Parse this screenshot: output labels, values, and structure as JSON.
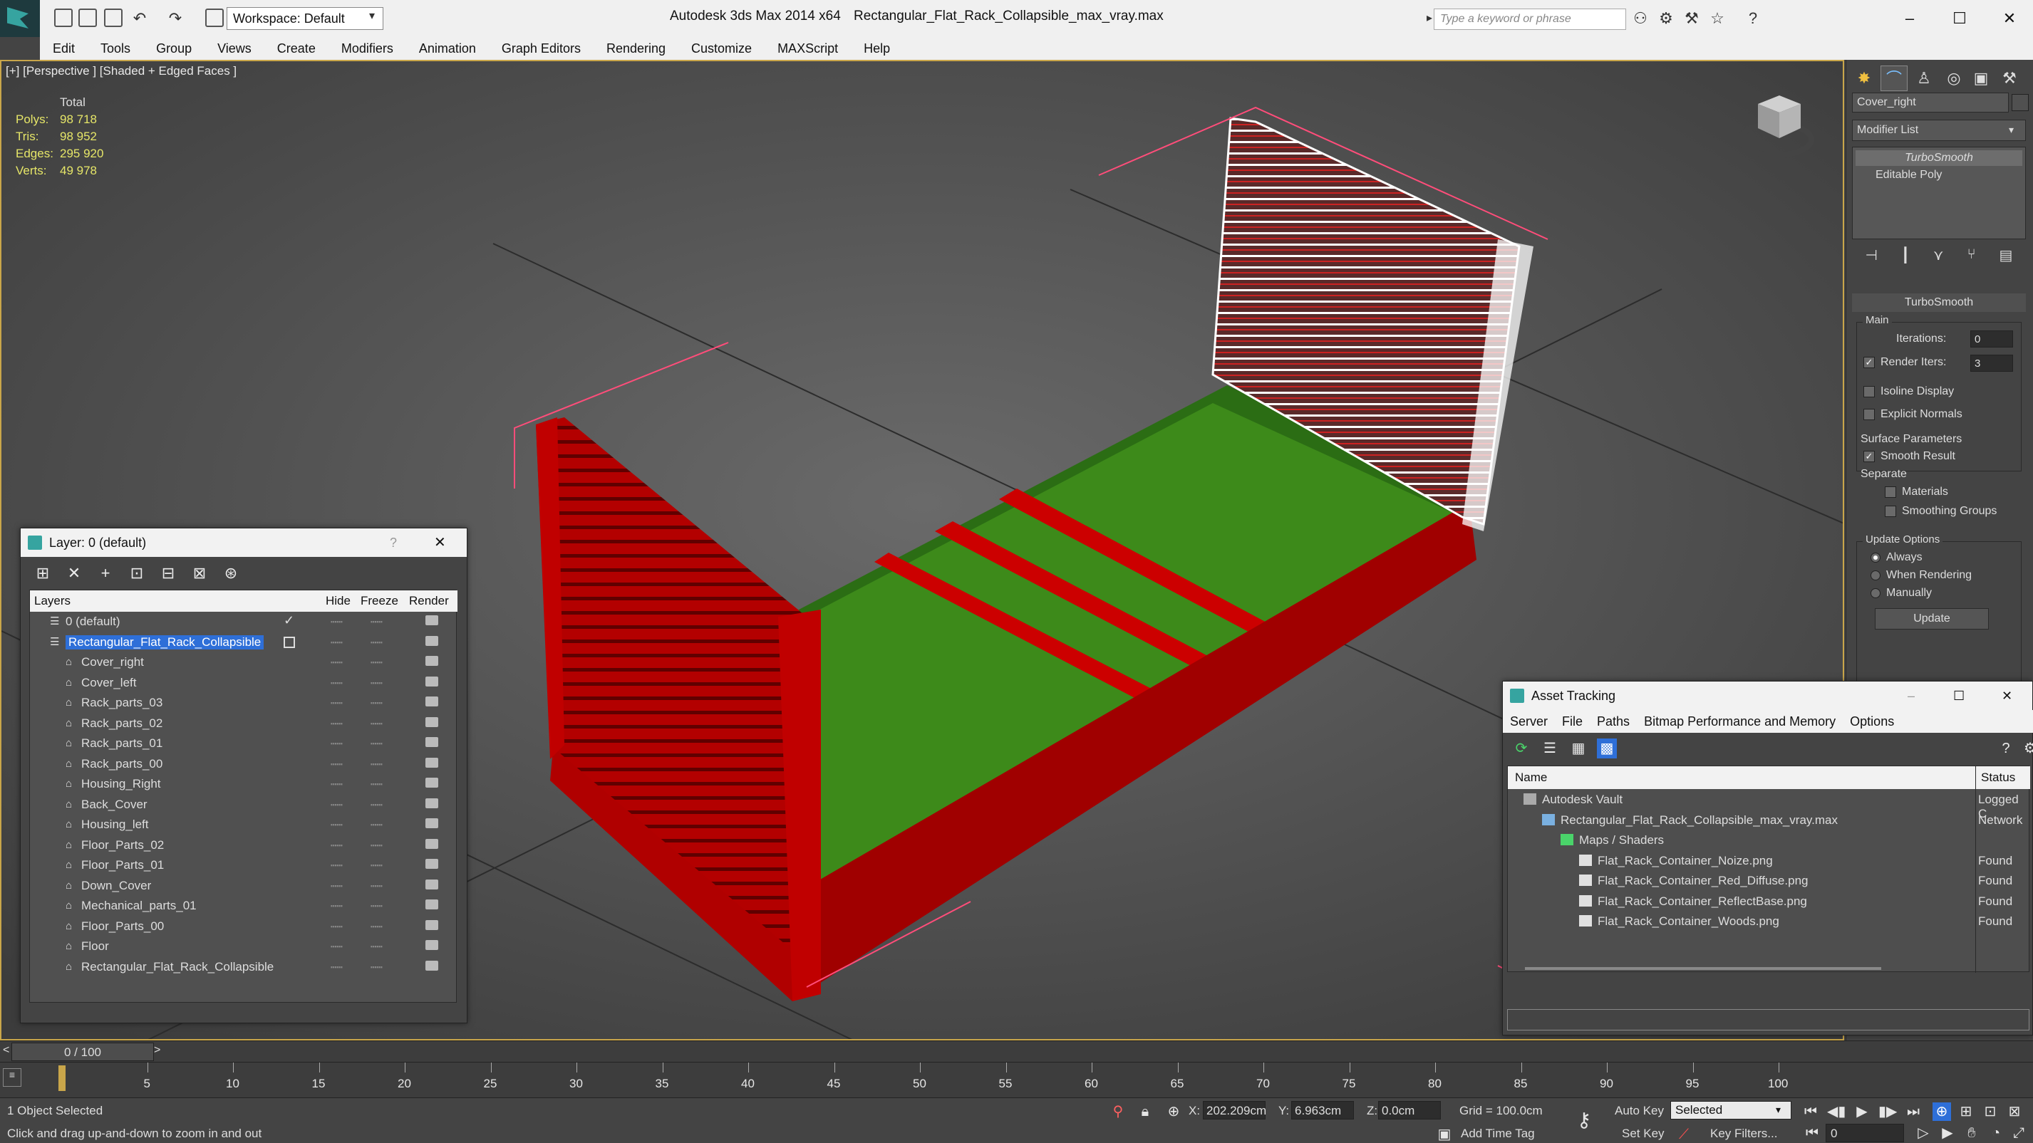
{
  "titlebar": {
    "workspace": "Workspace: Default",
    "app_title": "Autodesk 3ds Max  2014 x64",
    "doc_title": "Rectangular_Flat_Rack_Collapsible_max_vray.max",
    "search_placeholder": "Type a keyword or phrase"
  },
  "menu": [
    "Edit",
    "Tools",
    "Group",
    "Views",
    "Create",
    "Modifiers",
    "Animation",
    "Graph Editors",
    "Rendering",
    "Customize",
    "MAXScript",
    "Help"
  ],
  "viewport": {
    "label": "[+] [Perspective ] [Shaded + Edged Faces ]",
    "stats_header": "Total",
    "stats": [
      {
        "k": "Polys:",
        "v": "98 718"
      },
      {
        "k": "Tris:",
        "v": "98 952"
      },
      {
        "k": "Edges:",
        "v": "295 920"
      },
      {
        "k": "Verts:",
        "v": "49 978"
      }
    ],
    "colors": {
      "floor": "#3d8a1a",
      "frame": "#cc0000",
      "selected_wire": "#ffffff",
      "background": "#5a5a5a"
    }
  },
  "command_panel": {
    "object_name": "Cover_right",
    "modifier_list": "Modifier List",
    "stack": [
      "TurboSmooth",
      "Editable Poly"
    ],
    "rollout": "TurboSmooth",
    "main_label": "Main",
    "iterations_label": "Iterations:",
    "iterations": "0",
    "render_iters_label": "Render Iters:",
    "render_iters": "3",
    "isoline": "Isoline Display",
    "explicit_normals": "Explicit Normals",
    "surface_params": "Surface Parameters",
    "smooth_result": "Smooth Result",
    "separate": "Separate",
    "materials": "Materials",
    "smoothing_groups": "Smoothing Groups",
    "update_options": "Update Options",
    "always": "Always",
    "when_rendering": "When Rendering",
    "manually": "Manually",
    "update_button": "Update"
  },
  "layer_panel": {
    "title": "Layer: 0 (default)",
    "help": "?",
    "columns": {
      "layers": "Layers",
      "hide": "Hide",
      "freeze": "Freeze",
      "render": "Render"
    },
    "rows": [
      {
        "name": "0 (default)",
        "top": true
      },
      {
        "name": "Rectangular_Flat_Rack_Collapsible",
        "top": true,
        "selected": true
      },
      {
        "name": "Cover_right"
      },
      {
        "name": "Cover_left"
      },
      {
        "name": "Rack_parts_03"
      },
      {
        "name": "Rack_parts_02"
      },
      {
        "name": "Rack_parts_01"
      },
      {
        "name": "Rack_parts_00"
      },
      {
        "name": "Housing_Right"
      },
      {
        "name": "Back_Cover"
      },
      {
        "name": "Housing_left"
      },
      {
        "name": "Floor_Parts_02"
      },
      {
        "name": "Floor_Parts_01"
      },
      {
        "name": "Down_Cover"
      },
      {
        "name": "Mechanical_parts_01"
      },
      {
        "name": "Floor_Parts_00"
      },
      {
        "name": "Floor"
      },
      {
        "name": "Rectangular_Flat_Rack_Collapsible"
      }
    ]
  },
  "asset_panel": {
    "title": "Asset Tracking",
    "menu": [
      "Server",
      "File",
      "Paths",
      "Bitmap Performance and Memory",
      "Options"
    ],
    "columns": {
      "name": "Name",
      "status": "Status"
    },
    "rows": [
      {
        "name": "Autodesk Vault",
        "status": "Logged C",
        "indent": 0,
        "icon": "vault-icon"
      },
      {
        "name": "Rectangular_Flat_Rack_Collapsible_max_vray.max",
        "status": "Network",
        "indent": 1,
        "icon": "max-file-icon"
      },
      {
        "name": "Maps / Shaders",
        "status": "",
        "indent": 2,
        "icon": "maps-icon"
      },
      {
        "name": "Flat_Rack_Container_Noize.png",
        "status": "Found",
        "indent": 3,
        "icon": "png-icon"
      },
      {
        "name": "Flat_Rack_Container_Red_Diffuse.png",
        "status": "Found",
        "indent": 3,
        "icon": "png-icon"
      },
      {
        "name": "Flat_Rack_Container_ReflectBase.png",
        "status": "Found",
        "indent": 3,
        "icon": "png-icon"
      },
      {
        "name": "Flat_Rack_Container_Woods.png",
        "status": "Found",
        "indent": 3,
        "icon": "png-icon"
      }
    ]
  },
  "timeline": {
    "slider_label": "0 / 100",
    "ticks": [
      "5",
      "10",
      "15",
      "20",
      "25",
      "30",
      "35",
      "40",
      "45",
      "50",
      "55",
      "60",
      "65",
      "70",
      "75",
      "80",
      "85",
      "90",
      "95",
      "100"
    ]
  },
  "status": {
    "selection": "1 Object Selected",
    "prompt": "Click and drag up-and-down to zoom in and out",
    "x_label": "X:",
    "x": "202.209cm",
    "y_label": "Y:",
    "y": "6.963cm",
    "z_label": "Z:",
    "z": "0.0cm",
    "grid": "Grid = 100.0cm",
    "auto_key": "Auto Key",
    "set_key": "Set Key",
    "selected": "Selected",
    "key_filters": "Key Filters...",
    "add_time_tag": "Add Time Tag",
    "frame": "0"
  }
}
